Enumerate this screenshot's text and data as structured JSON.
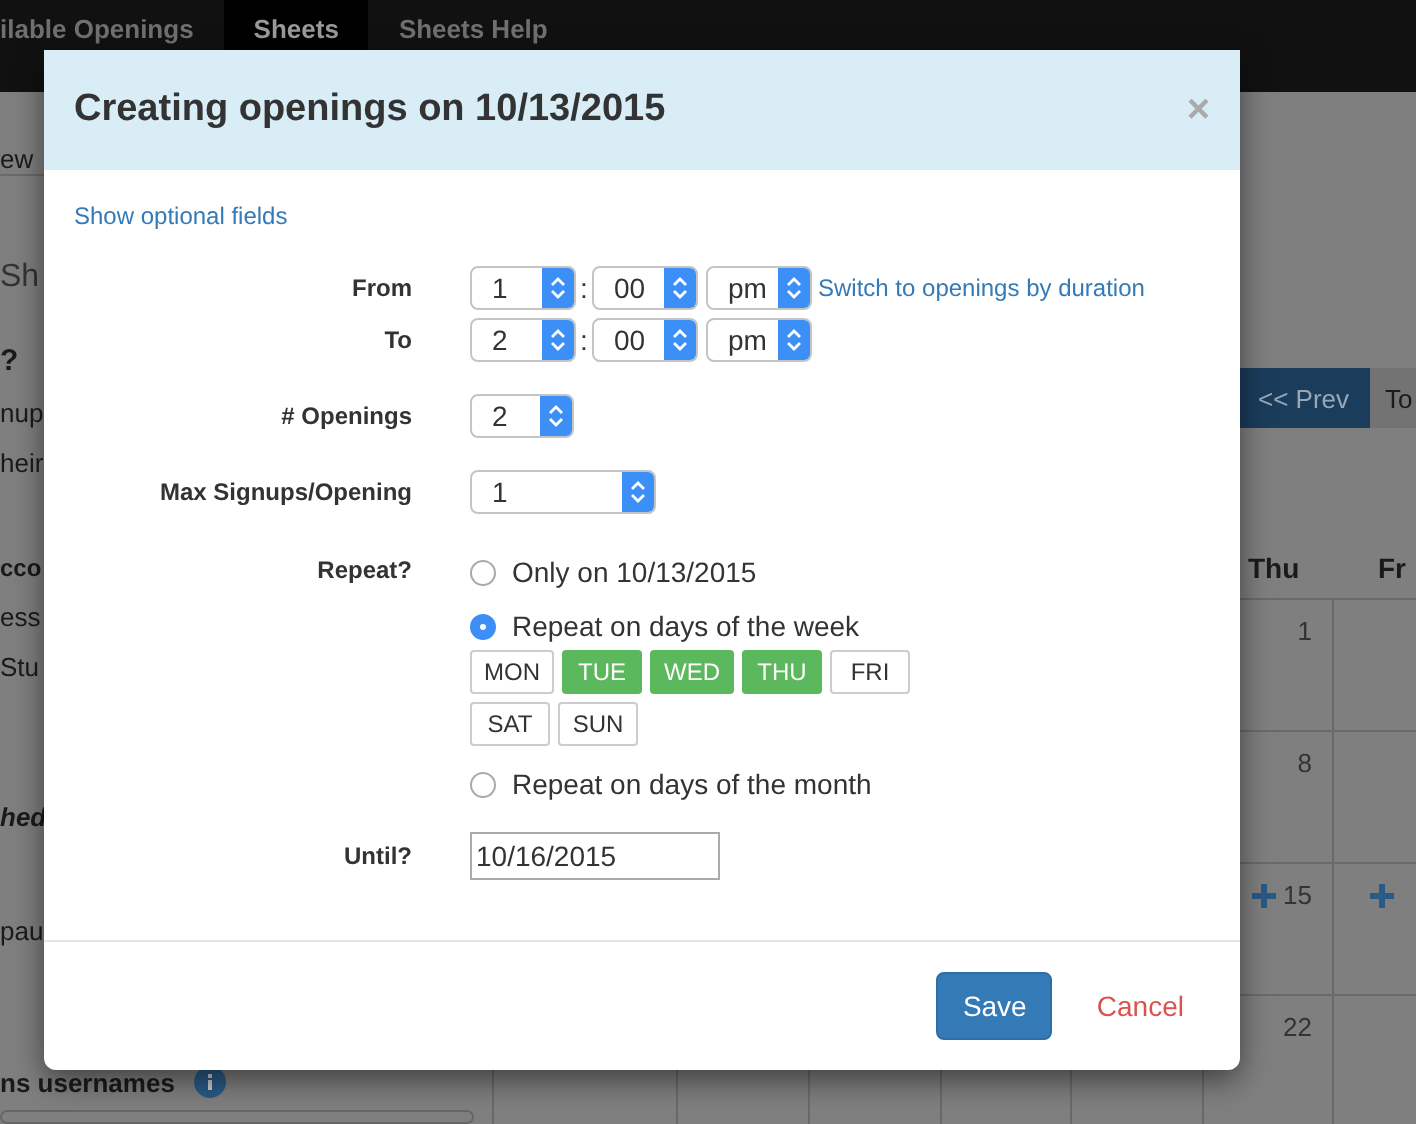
{
  "navbar": {
    "tabs": [
      {
        "label": "ilable Openings",
        "selected": false
      },
      {
        "label": "Sheets",
        "selected": true
      },
      {
        "label": "Sheets Help",
        "selected": false
      }
    ]
  },
  "left_panel": {
    "items": [
      {
        "text": "ew",
        "kind": "tab"
      },
      {
        "text": "Sh",
        "kind": "heading"
      },
      {
        "text": "?",
        "kind": "bold"
      },
      {
        "text": "nup",
        "kind": "plain"
      },
      {
        "text": "heir",
        "kind": "plain"
      },
      {
        "text": "cco",
        "kind": "bold"
      },
      {
        "text": "ess",
        "kind": "plain"
      },
      {
        "text": "Stu",
        "kind": "plain"
      },
      {
        "text": "hed",
        "kind": "bolditalic"
      },
      {
        "text": "pau",
        "kind": "plain"
      },
      {
        "text": "ns usernames",
        "kind": "info"
      }
    ]
  },
  "calendar": {
    "prev_button": "<< Prev",
    "today_button": "To",
    "day_headers": [
      "Thu",
      "Fr"
    ],
    "rows": [
      {
        "date": "1",
        "add": false,
        "next_add": false
      },
      {
        "date": "8",
        "add": false,
        "next_add": false
      },
      {
        "date": "15",
        "add": true,
        "next_add": true
      },
      {
        "date": "22",
        "add": false,
        "next_add": false
      }
    ]
  },
  "modal": {
    "title": "Creating openings on 10/13/2015",
    "close": "×",
    "optional_link": "Show optional fields",
    "time_separator": ":",
    "from": {
      "label": "From",
      "hour": "1",
      "minute": "00",
      "ampm": "pm",
      "link": "Switch to openings by duration"
    },
    "to": {
      "label": "To",
      "hour": "2",
      "minute": "00",
      "ampm": "pm"
    },
    "openings": {
      "label": "# Openings",
      "value": "2"
    },
    "max_signups": {
      "label": "Max Signups/Opening",
      "value": "1"
    },
    "repeat": {
      "label": "Repeat?",
      "options": [
        {
          "label": "Only on 10/13/2015",
          "selected": false
        },
        {
          "label": "Repeat on days of the week",
          "selected": true,
          "days": [
            {
              "label": "MON",
              "selected": false
            },
            {
              "label": "TUE",
              "selected": true
            },
            {
              "label": "WED",
              "selected": true
            },
            {
              "label": "THU",
              "selected": true
            },
            {
              "label": "FRI",
              "selected": false
            },
            {
              "label": "SAT",
              "selected": false
            },
            {
              "label": "SUN",
              "selected": false
            }
          ]
        },
        {
          "label": "Repeat on days of the month",
          "selected": false
        }
      ]
    },
    "until": {
      "label": "Until?",
      "value": "10/16/2015"
    },
    "save": "Save",
    "cancel": "Cancel"
  }
}
